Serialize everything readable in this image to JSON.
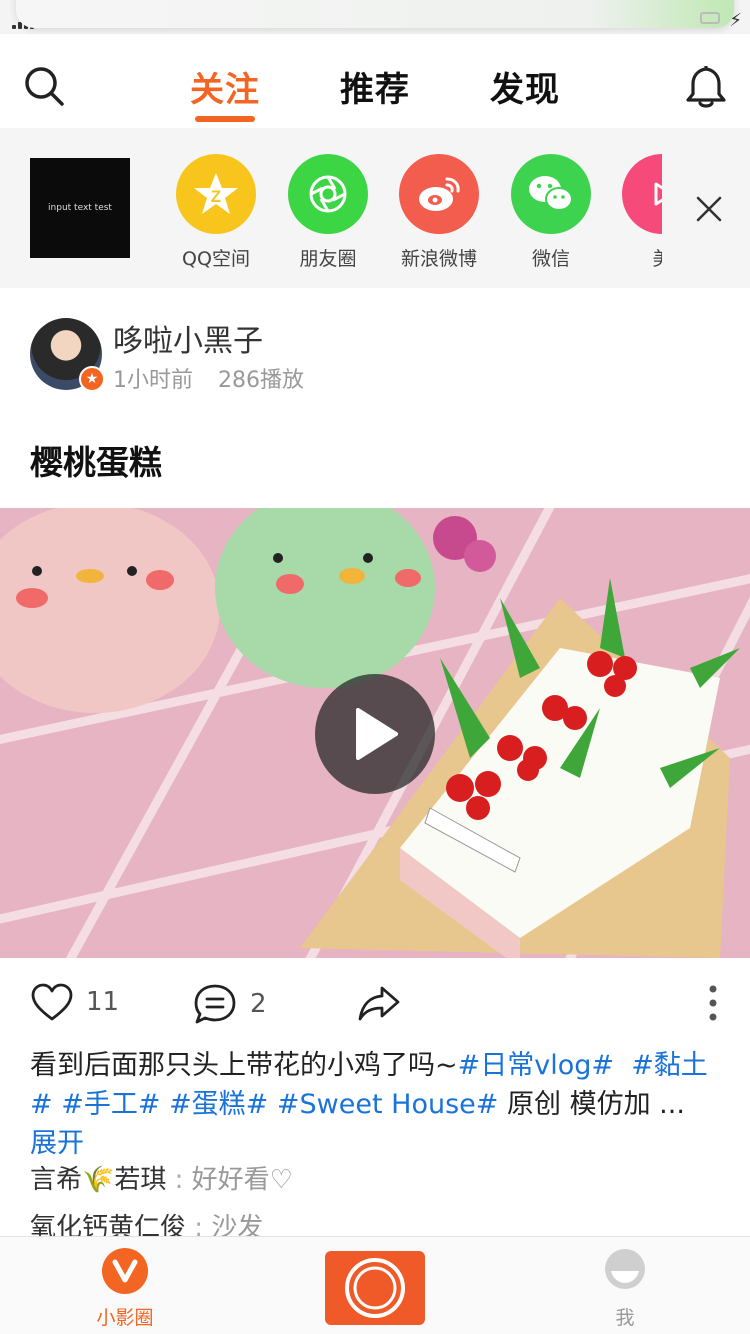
{
  "status_bar": {
    "signal": "signal-icon",
    "battery": "battery-charging-icon"
  },
  "top_nav": {
    "tabs": [
      {
        "label": "关注",
        "active": true
      },
      {
        "label": "推荐",
        "active": false
      },
      {
        "label": "发现",
        "active": false
      }
    ],
    "search_icon": "search-icon",
    "bell_icon": "bell-icon",
    "accent_color": "#f26522"
  },
  "share_strip": {
    "thumbnail_text": "input text test",
    "items": [
      {
        "label": "QQ空间",
        "icon": "qzone-icon",
        "color": "#f7c51c"
      },
      {
        "label": "朋友圈",
        "icon": "moments-icon",
        "color": "#3cd645"
      },
      {
        "label": "新浪微博",
        "icon": "weibo-icon",
        "color": "#f35d4e"
      },
      {
        "label": "微信",
        "icon": "wechat-icon",
        "color": "#3ed34e"
      },
      {
        "label": "美",
        "icon": "meipai-icon",
        "color": "#f64b7a"
      }
    ],
    "close_icon": "close-icon"
  },
  "post": {
    "author": "哆啦小黑子",
    "time": "1小时前",
    "plays": "286播放",
    "title": "樱桃蛋糕",
    "likes": "11",
    "comments_count": "2",
    "caption": {
      "text": "看到后面那只头上带花的小鸡了吗~",
      "tags": [
        "#日常vlog#",
        "#黏土#",
        "#手工#",
        "#蛋糕#",
        "#Sweet House#"
      ],
      "tail": "原创 模仿加 ...",
      "expand": "展开"
    },
    "comments": [
      {
        "user": "言希🌾若琪",
        "text": "好好看♡"
      },
      {
        "user": "氧化钙黄仁俊",
        "text": "沙发"
      }
    ]
  },
  "bottom_bar": {
    "items": [
      {
        "label": "小影圈",
        "active": true
      },
      {
        "label": "我",
        "active": false
      }
    ],
    "record_button": "record-icon"
  }
}
